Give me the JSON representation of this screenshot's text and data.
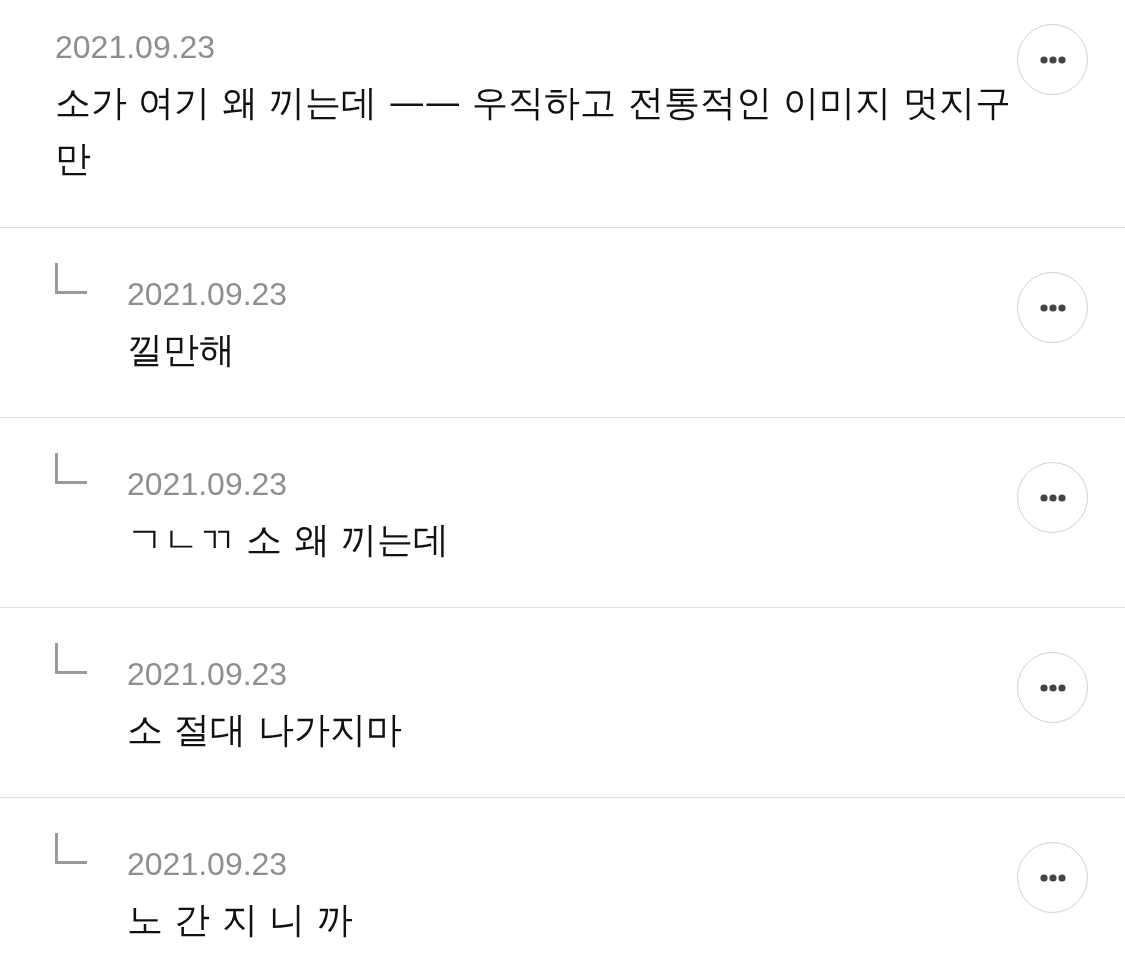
{
  "comments": [
    {
      "kind": "comment",
      "date": "2021.09.23",
      "text": "소가 여기 왜 끼는데 —— 우직하고 전통적인 이미지 멋지구만"
    },
    {
      "kind": "reply",
      "date": "2021.09.23",
      "text": "낄만해"
    },
    {
      "kind": "reply",
      "date": "2021.09.23",
      "text": "ㄱㄴㄲ 소 왜 끼는데"
    },
    {
      "kind": "reply",
      "date": "2021.09.23",
      "text": "소 절대 나가지마"
    },
    {
      "kind": "reply",
      "date": "2021.09.23",
      "text": "노 간 지 니 까"
    }
  ]
}
